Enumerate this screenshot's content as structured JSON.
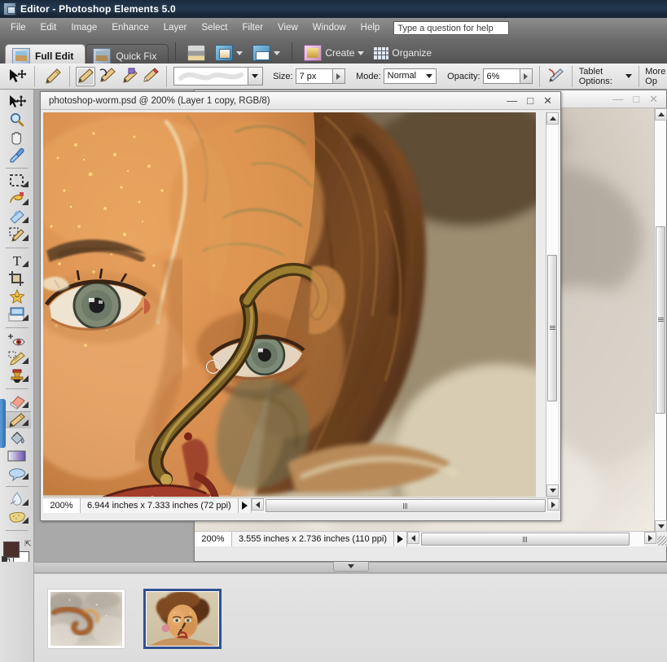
{
  "window": {
    "title": "Editor - Photoshop Elements 5.0",
    "app_icon": "photoshop-elements-icon"
  },
  "menubar": {
    "items": [
      "File",
      "Edit",
      "Image",
      "Enhance",
      "Layer",
      "Select",
      "Filter",
      "View",
      "Window",
      "Help"
    ],
    "help_search_placeholder": "Type a question for help",
    "help_search_value": "Type a question for help"
  },
  "shortcutbar": {
    "tabs": [
      {
        "label": "Full Edit",
        "icon": "full-edit-icon",
        "active": true
      },
      {
        "label": "Quick Fix",
        "icon": "quick-fix-icon",
        "active": false
      }
    ],
    "buttons": [
      {
        "label": "",
        "icon": "print-icon",
        "has_caret": false
      },
      {
        "label": "",
        "icon": "order-prints-icon",
        "has_caret": true
      },
      {
        "label": "",
        "icon": "email-icon",
        "has_caret": true
      },
      {
        "label": "Create",
        "icon": "create-icon",
        "has_caret": true
      },
      {
        "label": "Organize",
        "icon": "organize-icon",
        "has_caret": false
      }
    ]
  },
  "optionsbar": {
    "active_tool_icon": "move-tool-icon",
    "brush_tool_icon": "brush-tool-icon",
    "mode_icons": [
      "brush-icon",
      "impressionist-brush-icon",
      "color-replacement-brush-icon",
      "pencil-icon"
    ],
    "brush_preset_label": "brush-stroke-preview",
    "size_label": "Size:",
    "size_value": "7 px",
    "mode_label": "Mode:",
    "mode_value": "Normal",
    "opacity_label": "Opacity:",
    "opacity_value": "6%",
    "airbrush_icon": "airbrush-icon",
    "tablet_options_label": "Tablet Options:",
    "more_options_label": "More Op"
  },
  "toolbox": {
    "tools": [
      {
        "name": "move-tool",
        "selected": false,
        "group": 0
      },
      {
        "name": "zoom-tool",
        "selected": false,
        "group": 0
      },
      {
        "name": "hand-tool",
        "selected": false,
        "group": 0
      },
      {
        "name": "eyedropper-tool",
        "selected": false,
        "group": 0
      },
      {
        "name": "marquee-tool",
        "selected": false,
        "group": 1
      },
      {
        "name": "lasso-tool",
        "selected": false,
        "group": 1
      },
      {
        "name": "magic-wand-tool",
        "selected": false,
        "group": 1
      },
      {
        "name": "selection-brush-tool",
        "selected": false,
        "group": 1
      },
      {
        "name": "type-tool",
        "selected": false,
        "group": 2
      },
      {
        "name": "crop-tool",
        "selected": false,
        "group": 2
      },
      {
        "name": "cookie-cutter-tool",
        "selected": false,
        "group": 2
      },
      {
        "name": "straighten-tool",
        "selected": false,
        "group": 2
      },
      {
        "name": "red-eye-removal-tool",
        "selected": false,
        "group": 3
      },
      {
        "name": "healing-brush-tool",
        "selected": false,
        "group": 3
      },
      {
        "name": "clone-stamp-tool",
        "selected": false,
        "group": 3
      },
      {
        "name": "eraser-tool",
        "selected": false,
        "group": 4
      },
      {
        "name": "brush-tool",
        "selected": true,
        "group": 4
      },
      {
        "name": "paint-bucket-tool",
        "selected": false,
        "group": 4
      },
      {
        "name": "gradient-tool",
        "selected": false,
        "group": 4
      },
      {
        "name": "shape-tool",
        "selected": false,
        "group": 4
      },
      {
        "name": "blur-tool",
        "selected": false,
        "group": 5
      },
      {
        "name": "sponge-tool",
        "selected": false,
        "group": 5
      }
    ],
    "foreground_color": "#4a2f2c",
    "background_color": "#ffffff",
    "swap_icon": "swap-colors-icon",
    "default_colors_icon": "default-colors-icon"
  },
  "documents": {
    "background": {
      "title": "",
      "status_zoom": "200%",
      "status_info": "3.555 inches x 2.736 inches (110 ppi)",
      "minimize_icon": "minimize-icon",
      "maximize_icon": "maximize-icon",
      "close_icon": "close-icon"
    },
    "active": {
      "title": "photoshop-worm.psd @ 200% (Layer 1 copy, RGB/8)",
      "status_zoom": "200%",
      "status_info": "6.944 inches x 7.333 inches (72 ppi)",
      "minimize_icon": "minimize-icon",
      "maximize_icon": "maximize-icon",
      "close_icon": "close-icon"
    }
  },
  "photobin": {
    "items": [
      {
        "name": "photo-bin-thumb-worm",
        "selected": false
      },
      {
        "name": "photo-bin-thumb-face",
        "selected": true
      }
    ],
    "collapse_icon": "collapse-bin-icon"
  },
  "colors": {
    "titlebar_dark": "#1b2a3d",
    "menubar_gray": "#7e7e7e",
    "workspace_gray": "#a9a9a9",
    "selection_blue": "#31508f",
    "panel_light": "#e9e9e9"
  }
}
